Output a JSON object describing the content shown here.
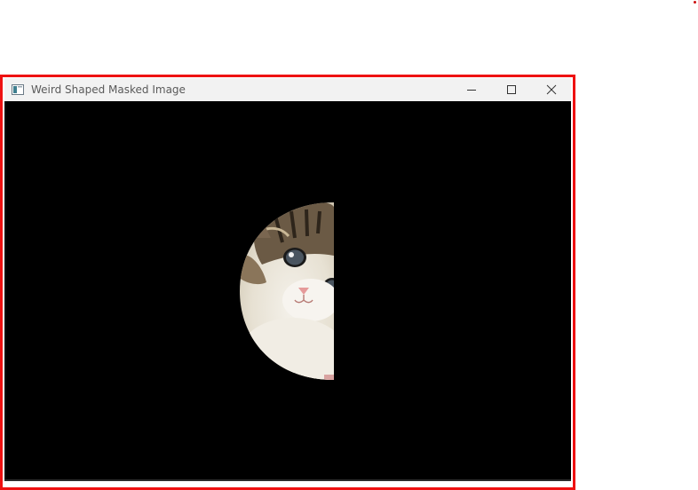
{
  "window": {
    "title": "Weird Shaped Masked Image",
    "controls": {
      "minimize": "minimize-icon",
      "maximize": "maximize-icon",
      "close": "close-icon"
    }
  },
  "content": {
    "background_color": "#000000",
    "image_subject": "kitten",
    "mask_shape": "left-half-ellipse"
  },
  "colors": {
    "highlight_border": "#ee1111",
    "titlebar": "#f2f2f2",
    "title_text": "#5a5a5a"
  }
}
